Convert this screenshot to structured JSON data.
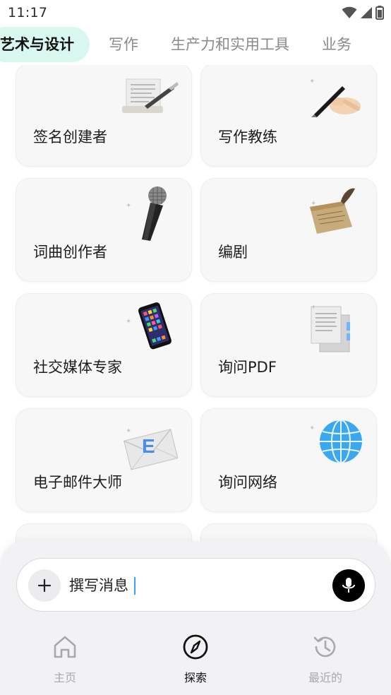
{
  "status_bar": {
    "time": "11:17",
    "icons": [
      "wifi-icon",
      "signal-icon",
      "battery-icon"
    ]
  },
  "tabs": [
    {
      "label": "艺术与设计",
      "active": true
    },
    {
      "label": "写作",
      "active": false
    },
    {
      "label": "生产力和实用工具",
      "active": false
    },
    {
      "label": "业务",
      "active": false
    }
  ],
  "cards": [
    {
      "label": "签名创建者",
      "icon": "paper-quill-icon"
    },
    {
      "label": "写作教练",
      "icon": "hand-pen-icon"
    },
    {
      "label": "词曲创作者",
      "icon": "microphone-icon"
    },
    {
      "label": "编剧",
      "icon": "scroll-feather-icon"
    },
    {
      "label": "社交媒体专家",
      "icon": "smartphone-icon"
    },
    {
      "label": "询问PDF",
      "icon": "documents-icon"
    },
    {
      "label": "电子邮件大师",
      "icon": "envelope-icon"
    },
    {
      "label": "询问网络",
      "icon": "globe-icon"
    }
  ],
  "composer": {
    "placeholder": "撰写消息",
    "value": "撰写消息"
  },
  "nav": {
    "home": "主页",
    "explore": "探索",
    "recent": "最近的"
  },
  "colors": {
    "active_tab_bg": "#d8f7ee",
    "nav_active": "#111111",
    "nav_inactive": "#a9a9ad",
    "caret": "#3aa0ff"
  }
}
